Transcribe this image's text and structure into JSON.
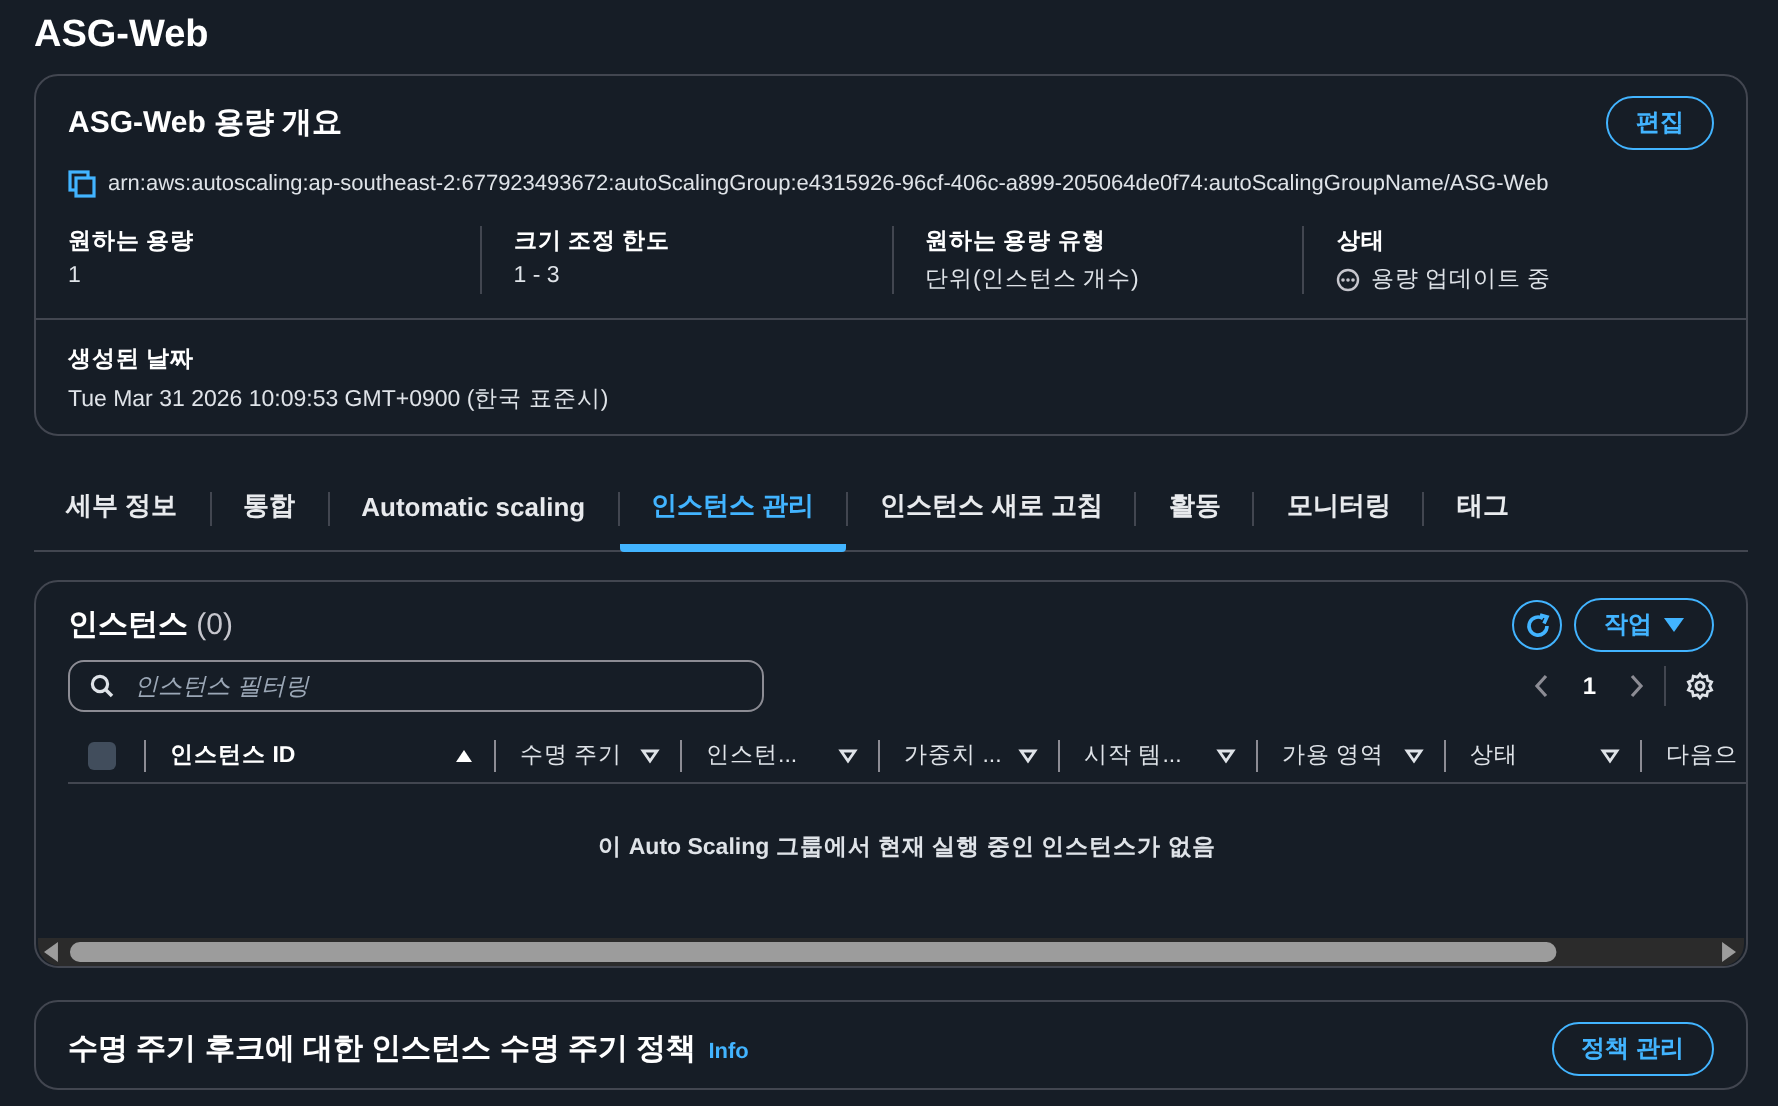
{
  "page_title": "ASG-Web",
  "overview": {
    "title": "ASG-Web 용량 개요",
    "edit_button": "편집",
    "arn": "arn:aws:autoscaling:ap-southeast-2:677923493672:autoScalingGroup:e4315926-96cf-406c-a899-205064de0f74:autoScalingGroupName/ASG-Web",
    "fields": [
      {
        "label": "원하는 용량",
        "value": "1",
        "kind": "text"
      },
      {
        "label": "크기 조정 한도",
        "value": "1 - 3",
        "kind": "text"
      },
      {
        "label": "원하는 용량 유형",
        "value": "단위(인스턴스 개수)",
        "kind": "text"
      },
      {
        "label": "상태",
        "value": "용량 업데이트 중",
        "kind": "status"
      }
    ],
    "created": {
      "label": "생성된 날짜",
      "value": "Tue Mar 31 2026 10:09:53 GMT+0900 (한국 표준시)"
    }
  },
  "tabs": [
    {
      "label": "세부 정보",
      "selected": false
    },
    {
      "label": "통합",
      "selected": false
    },
    {
      "label": "Automatic scaling",
      "selected": false
    },
    {
      "label": "인스턴스 관리",
      "selected": true
    },
    {
      "label": "인스턴스 새로 고침",
      "selected": false
    },
    {
      "label": "활동",
      "selected": false
    },
    {
      "label": "모니터링",
      "selected": false
    },
    {
      "label": "태그",
      "selected": false
    }
  ],
  "instances": {
    "title": "인스턴스",
    "count": "(0)",
    "actions_button": "작업",
    "filter": {
      "placeholder": "인스턴스 필터링"
    },
    "page": "1",
    "select_all": {
      "checked": false
    },
    "columns": [
      {
        "label": "인스턴스 ID",
        "sorted": true
      },
      {
        "label": "수명 주기",
        "sorted": false
      },
      {
        "label": "인스턴...",
        "sorted": false
      },
      {
        "label": "가중치 ...",
        "sorted": false
      },
      {
        "label": "시작 템...",
        "sorted": false
      },
      {
        "label": "가용 영역",
        "sorted": false
      },
      {
        "label": "상태",
        "sorted": false
      },
      {
        "label": "다음으"
      }
    ],
    "empty_message": "이 Auto Scaling 그룹에서 현재 실행 중인 인스턴스가 없음"
  },
  "lifecycle": {
    "title": "수명 주기 후크에 대한 인스턴스 수명 주기 정책",
    "info": "Info",
    "button": "정책 관리"
  }
}
